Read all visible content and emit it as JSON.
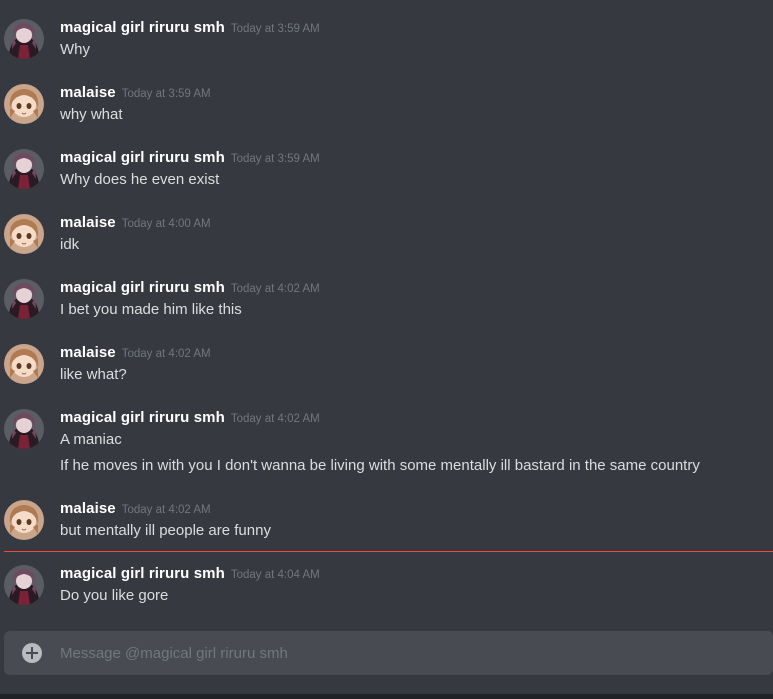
{
  "users": {
    "riruru": {
      "name": "magical girl riruru smh"
    },
    "malaise": {
      "name": "malaise"
    }
  },
  "messages": [
    {
      "user": "magical girl riruru smh",
      "avatar": "riruru-avatar",
      "time": "Today at 3:59 AM",
      "lines": [
        "Why"
      ]
    },
    {
      "user": "malaise",
      "avatar": "malaise-avatar",
      "time": "Today at 3:59 AM",
      "lines": [
        "why what"
      ]
    },
    {
      "user": "magical girl riruru smh",
      "avatar": "riruru-avatar",
      "time": "Today at 3:59 AM",
      "lines": [
        "Why does he even exist"
      ]
    },
    {
      "user": "malaise",
      "avatar": "malaise-avatar",
      "time": "Today at 4:00 AM",
      "lines": [
        "idk"
      ]
    },
    {
      "user": "magical girl riruru smh",
      "avatar": "riruru-avatar",
      "time": "Today at 4:02 AM",
      "lines": [
        "I bet you made him like this"
      ]
    },
    {
      "user": "malaise",
      "avatar": "malaise-avatar",
      "time": "Today at 4:02 AM",
      "lines": [
        "like what?"
      ]
    },
    {
      "user": "magical girl riruru smh",
      "avatar": "riruru-avatar",
      "time": "Today at 4:02 AM",
      "lines": [
        "A maniac",
        "If he moves in with you I don't wanna be living with some mentally ill bastard in the same country"
      ]
    },
    {
      "user": "malaise",
      "avatar": "malaise-avatar",
      "time": "Today at 4:02 AM",
      "lines": [
        "but mentally ill people are funny"
      ]
    },
    {
      "user": "magical girl riruru smh",
      "avatar": "riruru-avatar",
      "time": "Today at 4:04 AM",
      "lines": [
        "Do you like gore"
      ]
    }
  ],
  "composer": {
    "placeholder": "Message @magical girl riruru smh",
    "value": "",
    "attach_icon": "plus-circle-icon"
  },
  "colors": {
    "background": "#36393f",
    "composer": "#484c52",
    "new_messages_divider": "#f04747",
    "username": "#ffffff",
    "message_text": "#dcddde",
    "timestamp": "#72767d"
  }
}
